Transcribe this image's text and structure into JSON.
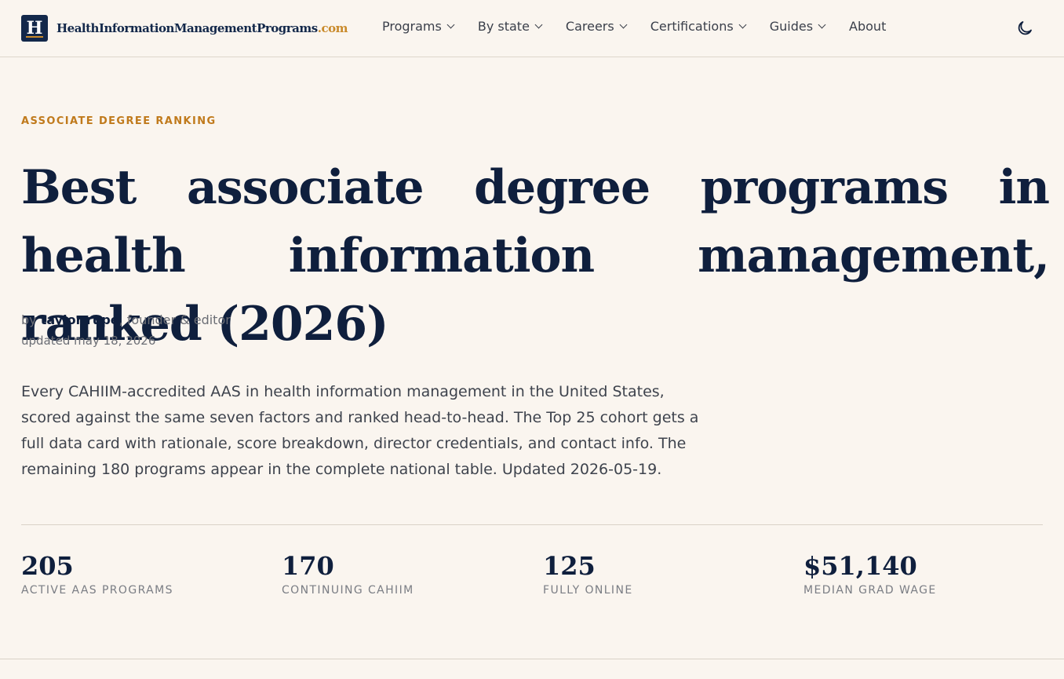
{
  "nav": {
    "logo_letter": "H",
    "logo_name": "HealthInformationManagementPrograms",
    "logo_tld": ".com",
    "menu": [
      {
        "label": "Programs",
        "has_dropdown": true
      },
      {
        "label": "By state",
        "has_dropdown": true
      },
      {
        "label": "Careers",
        "has_dropdown": true
      },
      {
        "label": "Certifications",
        "has_dropdown": true
      },
      {
        "label": "Guides",
        "has_dropdown": true
      },
      {
        "label": "About",
        "has_dropdown": false
      }
    ],
    "theme_toggle_icon": "moon-icon"
  },
  "article": {
    "eyebrow": "ASSOCIATE DEGREE RANKING",
    "title": "Best associate degree programs in health information management, ranked (2026)",
    "byline_prefix": "by ",
    "author": "taylor rupe",
    "author_role": ", founder & editor",
    "updated": "updated may 18, 2026",
    "lead": "Every CAHIIM-accredited AAS in health information management in the United States, scored against the same seven factors and ranked head-to-head. The Top 25 cohort gets a full data card with rationale, score breakdown, director credentials, and contact info. The remaining 180 programs appear in the complete national table. Updated 2026-05-19."
  },
  "stats": [
    {
      "value": "205",
      "label": "ACTIVE AAS PROGRAMS"
    },
    {
      "value": "170",
      "label": "CONTINUING CAHIIM"
    },
    {
      "value": "125",
      "label": "FULLY ONLINE"
    },
    {
      "value": "$51,140",
      "label": "MEDIAN GRAD WAGE"
    }
  ],
  "colors": {
    "background": "#faf5ef",
    "navy": "#0f1f3d",
    "accent": "#c07a1c"
  }
}
